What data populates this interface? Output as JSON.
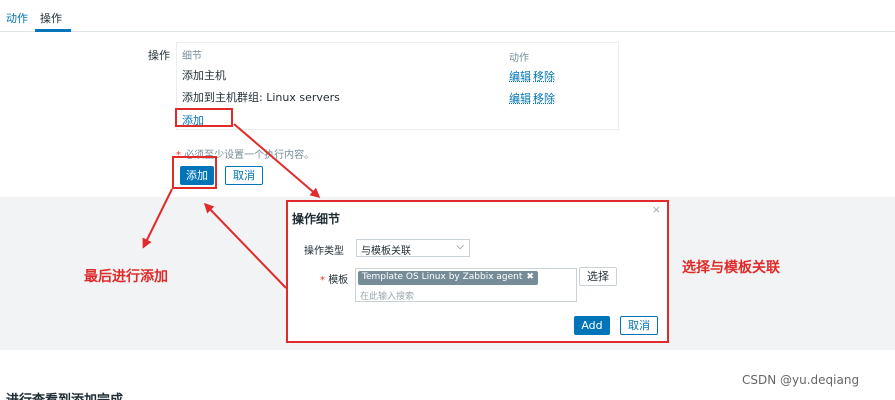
{
  "tabs": [
    {
      "label": "动作"
    },
    {
      "label": "操作"
    }
  ],
  "form": {
    "label": "操作"
  },
  "operations": {
    "columns": {
      "details": "细节",
      "action": "动作"
    },
    "rows": [
      {
        "detail": "添加主机",
        "edit": "编辑",
        "remove": "移除"
      },
      {
        "detail": "添加到主机群组: Linux servers",
        "edit": "编辑",
        "remove": "移除"
      }
    ],
    "add_link": "添加"
  },
  "required_note": {
    "star": "*",
    "text": "必须至少设置一个执行内容。"
  },
  "buttons": {
    "add": "添加",
    "cancel": "取消"
  },
  "modal": {
    "title": "操作细节",
    "close": "×",
    "op_type_label": "操作类型",
    "op_type_value": "与模板关联",
    "template_label_star": "*",
    "template_label": "模板",
    "template_chip": "Template OS Linux by Zabbix agent",
    "chip_remove": "✖",
    "search_placeholder": "在此输入搜索",
    "select_button": "选择",
    "add_button": "Add",
    "cancel_button": "取消"
  },
  "annotations": {
    "left": "最后进行添加",
    "right": "选择与模板关联"
  },
  "bottom_text": "进行查看到添加完成",
  "watermark": "CSDN @yu.deqiang",
  "icons": {
    "chevron": "chevron-down-icon",
    "close": "close-icon"
  },
  "colors": {
    "accent": "#0275b8",
    "annotation": "#e12b2b",
    "band": "#f1f3f4",
    "chip": "#768d99"
  }
}
